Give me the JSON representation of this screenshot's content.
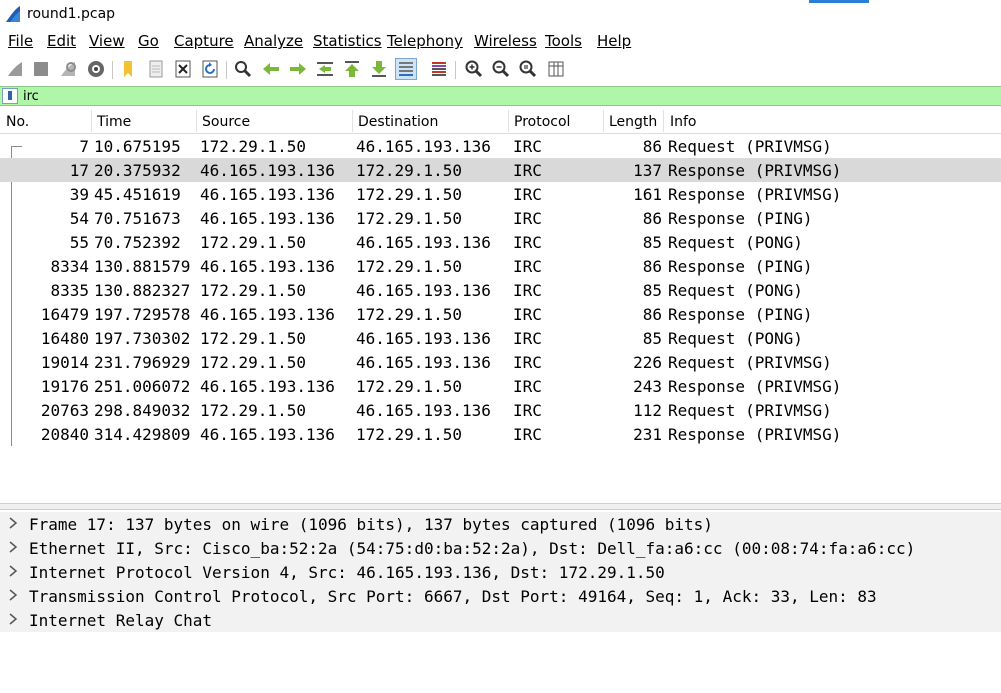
{
  "window": {
    "title": "round1.pcap",
    "app_icon": "wireshark-fin-icon",
    "accent_color": "#2a7fd4"
  },
  "menu": {
    "items": [
      {
        "label": "File"
      },
      {
        "label": "Edit"
      },
      {
        "label": "View"
      },
      {
        "label": "Go"
      },
      {
        "label": "Capture"
      },
      {
        "label": "Analyze"
      },
      {
        "label": "Statistics"
      },
      {
        "label": "Telephony"
      },
      {
        "label": "Wireless"
      },
      {
        "label": "Tools"
      },
      {
        "label": "Help"
      }
    ]
  },
  "toolbar": {
    "icons": [
      "start-capture-icon",
      "stop-capture-icon",
      "restart-capture-icon",
      "capture-options-icon",
      "open-file-icon",
      "save-file-icon",
      "close-file-icon",
      "reload-file-icon",
      "find-packet-icon",
      "go-back-icon",
      "go-forward-icon",
      "go-to-packet-icon",
      "go-first-icon",
      "go-last-icon",
      "autoscroll-icon",
      "colorize-icon",
      "zoom-in-icon",
      "zoom-out-icon",
      "normal-size-icon",
      "resize-columns-icon"
    ]
  },
  "filter": {
    "value": "irc",
    "bg_color": "#aff6a8"
  },
  "packet_list": {
    "columns": [
      "No.",
      "Time",
      "Source",
      "Destination",
      "Protocol",
      "Length",
      "Info"
    ],
    "selected_index": 1,
    "rows": [
      {
        "no": "7",
        "time": "10.675195",
        "src": "172.29.1.50",
        "dst": "46.165.193.136",
        "proto": "IRC",
        "len": "86",
        "info": "Request (PRIVMSG)"
      },
      {
        "no": "17",
        "time": "20.375932",
        "src": "46.165.193.136",
        "dst": "172.29.1.50",
        "proto": "IRC",
        "len": "137",
        "info": "Response (PRIVMSG)"
      },
      {
        "no": "39",
        "time": "45.451619",
        "src": "46.165.193.136",
        "dst": "172.29.1.50",
        "proto": "IRC",
        "len": "161",
        "info": "Response (PRIVMSG)"
      },
      {
        "no": "54",
        "time": "70.751673",
        "src": "46.165.193.136",
        "dst": "172.29.1.50",
        "proto": "IRC",
        "len": "86",
        "info": "Response (PING)"
      },
      {
        "no": "55",
        "time": "70.752392",
        "src": "172.29.1.50",
        "dst": "46.165.193.136",
        "proto": "IRC",
        "len": "85",
        "info": "Request (PONG)"
      },
      {
        "no": "8334",
        "time": "130.881579",
        "src": "46.165.193.136",
        "dst": "172.29.1.50",
        "proto": "IRC",
        "len": "86",
        "info": "Response (PING)"
      },
      {
        "no": "8335",
        "time": "130.882327",
        "src": "172.29.1.50",
        "dst": "46.165.193.136",
        "proto": "IRC",
        "len": "85",
        "info": "Request (PONG)"
      },
      {
        "no": "16479",
        "time": "197.729578",
        "src": "46.165.193.136",
        "dst": "172.29.1.50",
        "proto": "IRC",
        "len": "86",
        "info": "Response (PING)"
      },
      {
        "no": "16480",
        "time": "197.730302",
        "src": "172.29.1.50",
        "dst": "46.165.193.136",
        "proto": "IRC",
        "len": "85",
        "info": "Request (PONG)"
      },
      {
        "no": "19014",
        "time": "231.796929",
        "src": "172.29.1.50",
        "dst": "46.165.193.136",
        "proto": "IRC",
        "len": "226",
        "info": "Request (PRIVMSG)"
      },
      {
        "no": "19176",
        "time": "251.006072",
        "src": "46.165.193.136",
        "dst": "172.29.1.50",
        "proto": "IRC",
        "len": "243",
        "info": "Response (PRIVMSG)"
      },
      {
        "no": "20763",
        "time": "298.849032",
        "src": "172.29.1.50",
        "dst": "46.165.193.136",
        "proto": "IRC",
        "len": "112",
        "info": "Request (PRIVMSG)"
      },
      {
        "no": "20840",
        "time": "314.429809",
        "src": "46.165.193.136",
        "dst": "172.29.1.50",
        "proto": "IRC",
        "len": "231",
        "info": "Response (PRIVMSG)"
      }
    ]
  },
  "details": {
    "rows": [
      {
        "text": "Frame 17: 137 bytes on wire (1096 bits), 137 bytes captured (1096 bits)"
      },
      {
        "text": "Ethernet II, Src: Cisco_ba:52:2a (54:75:d0:ba:52:2a), Dst: Dell_fa:a6:cc (00:08:74:fa:a6:cc)"
      },
      {
        "text": "Internet Protocol Version 4, Src: 46.165.193.136, Dst: 172.29.1.50"
      },
      {
        "text": "Transmission Control Protocol, Src Port: 6667, Dst Port: 49164, Seq: 1, Ack: 33, Len: 83"
      },
      {
        "text": "Internet Relay Chat"
      }
    ],
    "expander_icon": "chevron-right-icon"
  }
}
